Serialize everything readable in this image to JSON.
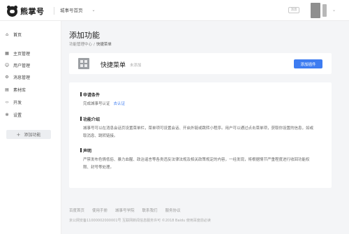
{
  "header": {
    "logo_text": "熊掌号",
    "account_label": "城事号首页",
    "msg_icon_text": "消息",
    "avatar_icon": "user-avatar"
  },
  "sidebar": {
    "items": [
      {
        "label": "首页",
        "icon": "home-icon"
      },
      {
        "label": "主页管理",
        "icon": "grid-icon"
      },
      {
        "label": "用户管理",
        "icon": "user-icon"
      },
      {
        "label": "消息管理",
        "icon": "gear-icon"
      },
      {
        "label": "素材库",
        "icon": "folder-icon"
      },
      {
        "label": "开发",
        "icon": "code-icon"
      },
      {
        "label": "设置",
        "icon": "settings-icon"
      }
    ],
    "add_button": "添加功能"
  },
  "main": {
    "title": "添加功能",
    "breadcrumb": {
      "parent": "功能管理中心",
      "sep": "/",
      "current": "快捷菜单"
    },
    "feature": {
      "name": "快捷菜单",
      "status": "未添加",
      "button": "添加插件"
    },
    "sections": {
      "conditions": {
        "title": "申请条件",
        "text": "完成城事号认证",
        "link": "去认证"
      },
      "intro": {
        "title": "功能介绍",
        "text": "城事号可以在消息会话页设置菜单栏，菜单项可设置会话、开启外链或跳转小程序。用户可以通过点击菜单项，获取你设置的信息，如或取消息、跳转链接。"
      },
      "notice": {
        "title": "声明",
        "text": "严禁发布色情低俗、暴力血腥、政治谣言等各类违反法律法规及相关政策规定的内容，一经发现，将根据情节严重程度进行收回功能权限、封号等处理。"
      }
    }
  },
  "footer": {
    "links": [
      "百度首页",
      "使用手册",
      "城事号学院",
      "联系我们",
      "服务协议"
    ],
    "copyright": "京公网安备11000002000001号  互联网新闻信息服务许可  ©2018 Baidu  使用百度前必读"
  },
  "colors": {
    "accent": "#3d7cf1",
    "background": "#f4f5f7"
  }
}
